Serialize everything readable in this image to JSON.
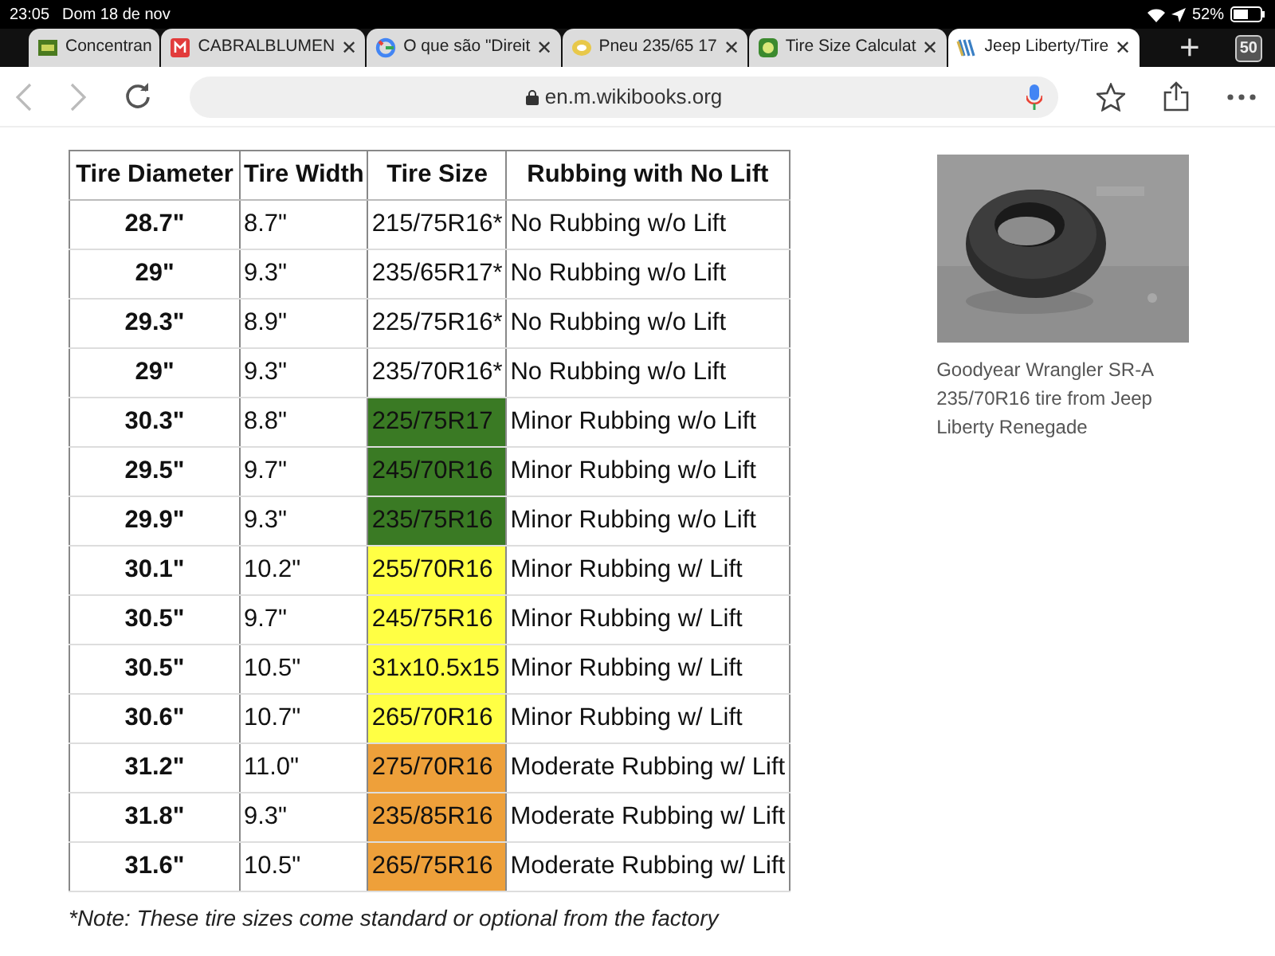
{
  "status_bar": {
    "time": "23:05",
    "date": "Dom 18 de nov",
    "battery": "52%"
  },
  "tabs": [
    {
      "title": "Concentran",
      "selected": false
    },
    {
      "title": "CABRALBLUMEN",
      "close": "✕",
      "selected": false
    },
    {
      "title": "O que são \"Direit",
      "close": "✕",
      "selected": false
    },
    {
      "title": "Pneu 235/65 17",
      "close": "✕",
      "selected": false
    },
    {
      "title": "Tire Size Calculat",
      "close": "✕",
      "selected": false
    },
    {
      "title": "Jeep Liberty/Tire",
      "close": "✕",
      "selected": true
    }
  ],
  "new_tab": "+",
  "tab_count": "50",
  "address_bar": {
    "url": "en.m.wikibooks.org"
  },
  "table": {
    "columns": [
      "Tire Diameter",
      "Tire Width",
      "Tire Size",
      "Rubbing with No Lift"
    ],
    "rows": [
      {
        "diameter": "28.7\"",
        "width": "8.7\"",
        "size": "215/75R16*",
        "rubbing": "No Rubbing w/o Lift"
      },
      {
        "diameter": "29\"",
        "width": "9.3\"",
        "size": "235/65R17*",
        "rubbing": "No Rubbing w/o Lift"
      },
      {
        "diameter": "29.3\"",
        "width": "8.9\"",
        "size": "225/75R16*",
        "rubbing": "No Rubbing w/o Lift"
      },
      {
        "diameter": "29\"",
        "width": "9.3\"",
        "size": "235/70R16*",
        "rubbing": "No Rubbing w/o Lift"
      },
      {
        "diameter": "30.3\"",
        "width": "8.8\"",
        "size": "225/75R17",
        "rubbing": "Minor Rubbing w/o Lift",
        "color": "#3a7a24"
      },
      {
        "diameter": "29.5\"",
        "width": "9.7\"",
        "size": "245/70R16",
        "rubbing": "Minor Rubbing w/o Lift",
        "color": "#3a7a24"
      },
      {
        "diameter": "29.9\"",
        "width": "9.3\"",
        "size": "235/75R16",
        "rubbing": "Minor Rubbing w/o Lift",
        "color": "#3a7a24"
      },
      {
        "diameter": "30.1\"",
        "width": "10.2\"",
        "size": "255/70R16",
        "rubbing": "Minor Rubbing w/ Lift",
        "color": "#ffff44"
      },
      {
        "diameter": "30.5\"",
        "width": "9.7\"",
        "size": "245/75R16",
        "rubbing": "Minor Rubbing w/ Lift",
        "color": "#ffff44"
      },
      {
        "diameter": "30.5\"",
        "width": "10.5\"",
        "size": "31x10.5x15",
        "rubbing": "Minor Rubbing w/ Lift",
        "color": "#ffff44"
      },
      {
        "diameter": "30.6\"",
        "width": "10.7\"",
        "size": "265/70R16",
        "rubbing": "Minor Rubbing w/ Lift",
        "color": "#ffff44"
      },
      {
        "diameter": "31.2\"",
        "width": "11.0\"",
        "size": "275/70R16",
        "rubbing": "Moderate Rubbing w/ Lift",
        "color": "#eea03a"
      },
      {
        "diameter": "31.8\"",
        "width": "9.3\"",
        "size": "235/85R16",
        "rubbing": "Moderate Rubbing w/ Lift",
        "color": "#eea03a"
      },
      {
        "diameter": "31.6\"",
        "width": "10.5\"",
        "size": "265/75R16",
        "rubbing": "Moderate Rubbing w/ Lift",
        "color": "#eea03a"
      }
    ]
  },
  "figure": {
    "kind": "picture",
    "caption": "Goodyear Wrangler SR-A 235/70R16 tire from Jeep Liberty Renegade"
  },
  "note": "*Note: These tire sizes come standard or optional from the factory"
}
